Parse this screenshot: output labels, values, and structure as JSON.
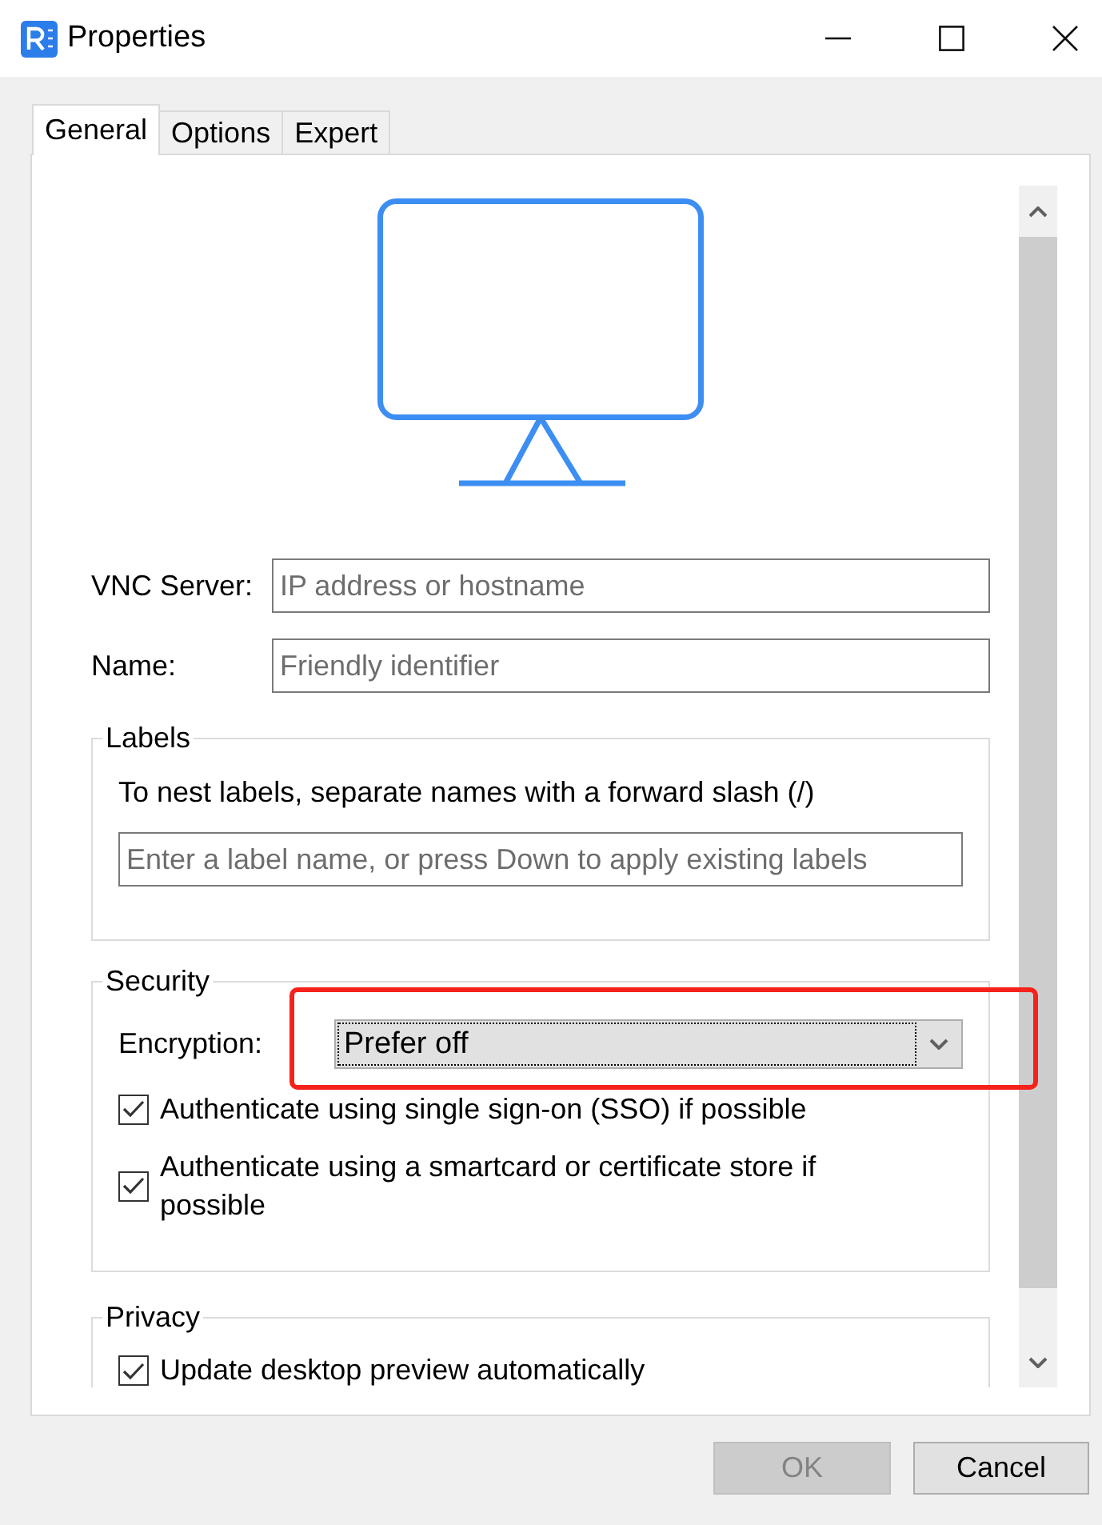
{
  "window": {
    "title": "Properties"
  },
  "tabs": [
    {
      "label": "General",
      "selected": true
    },
    {
      "label": "Options",
      "selected": false
    },
    {
      "label": "Expert",
      "selected": false
    }
  ],
  "fields": [
    {
      "label": "VNC Server:",
      "placeholder": "IP address or hostname"
    },
    {
      "label": "Name:",
      "placeholder": "Friendly identifier"
    }
  ],
  "labels": {
    "title": "Labels",
    "hint": "To nest labels, separate names with a forward slash (/)",
    "input": {
      "placeholder": "Enter a label name, or press Down to apply existing labels"
    }
  },
  "security": {
    "title": "Security",
    "encryption": {
      "label": "Encryption:",
      "value": "Prefer off",
      "focused": true,
      "highlighted": true
    },
    "checkboxes": [
      {
        "label": "Authenticate using single sign-on (SSO) if possible",
        "checked": true
      },
      {
        "label": "Authenticate using a smartcard or certificate store if possible",
        "checked": true
      }
    ]
  },
  "privacy": {
    "title": "Privacy",
    "checkboxes": [
      {
        "label": "Update desktop preview automatically",
        "checked": true
      }
    ]
  },
  "buttons": [
    {
      "kind": "ok",
      "label": "OK",
      "disabled": true
    },
    {
      "kind": "cancel",
      "label": "Cancel",
      "disabled": false
    }
  ]
}
